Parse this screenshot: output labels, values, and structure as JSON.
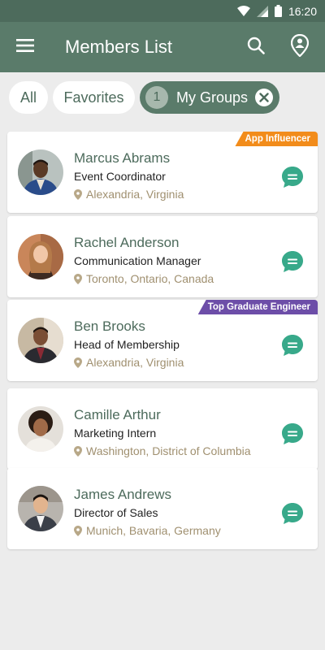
{
  "status_bar": {
    "time": "16:20"
  },
  "app_bar": {
    "title": "Members List",
    "menu_icon": "hamburger-menu-icon",
    "search_icon": "search-icon",
    "location_icon": "person-location-icon"
  },
  "filters": {
    "all_label": "All",
    "favorites_label": "Favorites",
    "groups_count": "1",
    "groups_label": "My Groups",
    "clear_icon": "close-icon"
  },
  "colors": {
    "primary": "#5a7b6a",
    "primary_dark": "#4d6b5c",
    "chat": "#38a98a",
    "influencer_badge": "#f28c1b",
    "graduate_badge": "#6d4ea8",
    "location_text": "#a09070"
  },
  "members": [
    {
      "name": "Marcus Abrams",
      "role": "Event Coordinator",
      "location": "Alexandria, Virginia",
      "badge": "App Influencer",
      "badge_color": "#f28c1b"
    },
    {
      "name": "Rachel Anderson",
      "role": "Communication Manager",
      "location": "Toronto, Ontario, Canada",
      "badge": "",
      "badge_color": ""
    },
    {
      "name": "Ben Brooks",
      "role": "Head of Membership",
      "location": "Alexandria, Virginia",
      "badge": "Top Graduate Engineer",
      "badge_color": "#6d4ea8"
    },
    {
      "name": "Camille Arthur",
      "role": "Marketing Intern",
      "location": "Washington, District of Columbia",
      "badge": "",
      "badge_color": ""
    },
    {
      "name": "James Andrews",
      "role": "Director of Sales",
      "location": "Munich, Bavaria, Germany",
      "badge": "",
      "badge_color": ""
    }
  ]
}
